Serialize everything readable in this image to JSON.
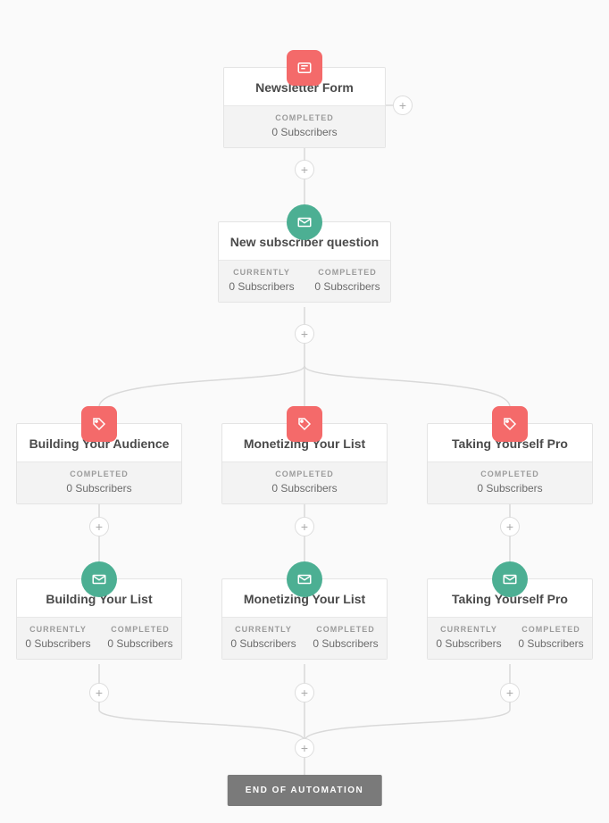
{
  "labels": {
    "completed": "COMPLETED",
    "currently": "CURRENTLY",
    "end": "END OF AUTOMATION",
    "plus": "+"
  },
  "nodes": {
    "form": {
      "title": "Newsletter Form",
      "stats": {
        "completed": "0 Subscribers"
      }
    },
    "question": {
      "title": "New subscriber question",
      "stats": {
        "currently": "0 Subscribers",
        "completed": "0 Subscribers"
      }
    },
    "col1": {
      "tag": {
        "title": "Building Your Audience",
        "stats": {
          "completed": "0 Subscribers"
        }
      },
      "seq": {
        "title": "Building Your List",
        "stats": {
          "currently": "0 Subscribers",
          "completed": "0 Subscribers"
        }
      }
    },
    "col2": {
      "tag": {
        "title": "Monetizing Your List",
        "stats": {
          "completed": "0 Subscribers"
        }
      },
      "seq": {
        "title": "Monetizing Your List",
        "stats": {
          "currently": "0 Subscribers",
          "completed": "0 Subscribers"
        }
      }
    },
    "col3": {
      "tag": {
        "title": "Taking Yourself Pro",
        "stats": {
          "completed": "0 Subscribers"
        }
      },
      "seq": {
        "title": "Taking Yourself Pro",
        "stats": {
          "currently": "0 Subscribers",
          "completed": "0 Subscribers"
        }
      }
    }
  }
}
